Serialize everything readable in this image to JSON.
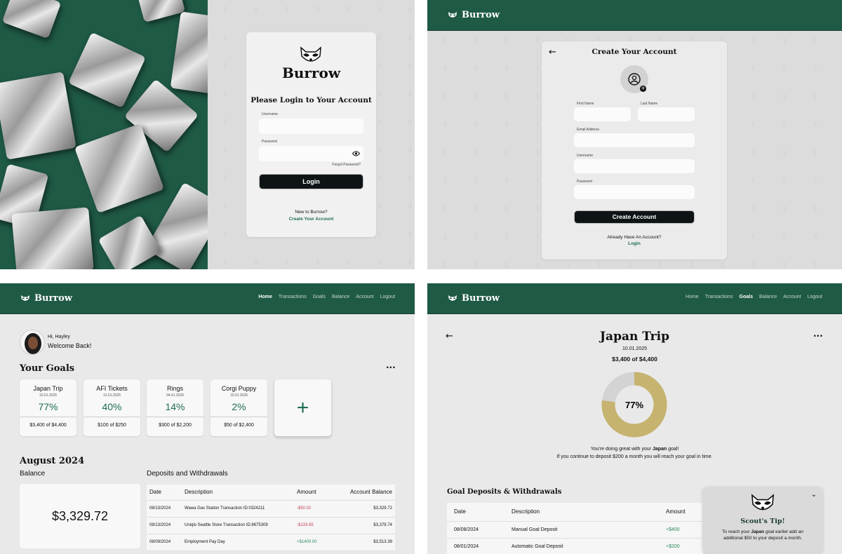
{
  "brand": "Burrow",
  "login": {
    "title": "Please Login to Your Account",
    "username_label": "Username",
    "password_label": "Password",
    "forgot": "Forgot Password?",
    "button": "Login",
    "new_text": "New to Burrow?",
    "create_link": "Create Your Account"
  },
  "signup": {
    "title": "Create Your Account",
    "first_name": "First Name",
    "last_name": "Last Name",
    "email": "Email Address",
    "username": "Username",
    "password": "Password",
    "button": "Create Account",
    "already": "Already Have An Account?",
    "login_link": "Login"
  },
  "nav": {
    "items": [
      "Home",
      "Transactions",
      "Goals",
      "Balance",
      "Account",
      "Logout"
    ]
  },
  "dashboard": {
    "greeting": "Hi, Hayley",
    "welcome": "Welcome Back!",
    "goals_title": "Your Goals",
    "more": "···",
    "add": "+",
    "goals": [
      {
        "name": "Japan Trip",
        "date": "10.01.2025",
        "pct": "77%",
        "amount": "$3,400 of $4,400"
      },
      {
        "name": "AFI Tickets",
        "date": "12.01.2025",
        "pct": "40%",
        "amount": "$100 of $250"
      },
      {
        "name": "Rings",
        "date": "04.01.2026",
        "pct": "14%",
        "amount": "$300 of $2,200"
      },
      {
        "name": "Corgi Puppy",
        "date": "10.01.2026",
        "pct": "2%",
        "amount": "$50 of $2,400"
      }
    ],
    "month": "August 2024",
    "balance_label": "Balance",
    "balance": "$3,329.72",
    "dw_title": "Deposits and Withdrawals",
    "headers": [
      "Date",
      "Description",
      "Amount",
      "Account Balance"
    ],
    "rows": [
      {
        "date": "08/13/2024",
        "desc": "Wawa Gas Station Transaction ID:0324211",
        "amount": "-$50.02",
        "balance": "$3,329.72",
        "neg": true
      },
      {
        "date": "08/13/2024",
        "desc": "Uniqlo Seattle Store Transaction ID:8675309",
        "amount": "-$133.65",
        "balance": "$3,379.74",
        "neg": true
      },
      {
        "date": "08/09/2024",
        "desc": "Employment Pay Day",
        "amount": "+$1400.00",
        "balance": "$3,513.39",
        "neg": false
      }
    ]
  },
  "goal_detail": {
    "title": "Japan Trip",
    "date": "10.01.2025",
    "progress": "$3,400 of $4,400",
    "pct_label": "77%",
    "pct_value": 0.77,
    "msg1_pre": "You're doing great with your ",
    "msg1_bold": "Japan",
    "msg1_post": " goal!",
    "msg2": "If you continue to deposit $200 a month you will reach your goal in time.",
    "dw_title": "Goal Deposits & Withdrawals",
    "headers": [
      "Date",
      "Description",
      "Amount"
    ],
    "rows": [
      {
        "date": "08/08/2024",
        "desc": "Manual Goal Deposit",
        "amount": "+$400"
      },
      {
        "date": "08/01/2024",
        "desc": "Automatic Goal Deposit",
        "amount": "+$200"
      }
    ],
    "tip_title": "Scout's Tip!",
    "tip_pre": "To reach your ",
    "tip_bold": "Japan",
    "tip_post": " goal earlier add an additional $50 to your deposit a month."
  },
  "colors": {
    "brand_green": "#1f5a45",
    "accent_green": "#1f6e50",
    "donut_gold": "#c6b36f",
    "negative": "#c2415a"
  }
}
